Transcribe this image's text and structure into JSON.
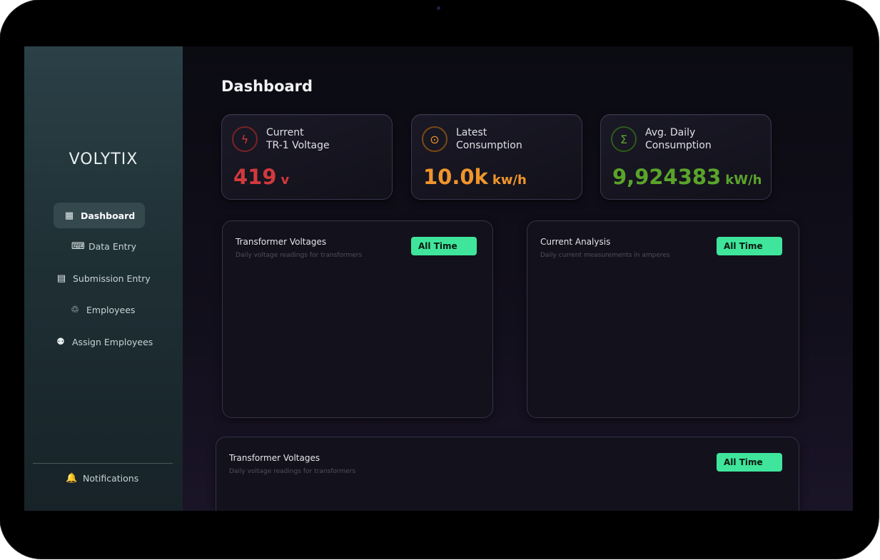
{
  "sidebar": {
    "brand": "VOLYTIX",
    "items": [
      {
        "label": "Dashboard",
        "icon": "dashboard-icon"
      },
      {
        "label": "Data Entry",
        "icon": "keyboard-icon"
      },
      {
        "label": "Submission Entry",
        "icon": "form-icon"
      },
      {
        "label": "Employees",
        "icon": "employees-icon"
      },
      {
        "label": "Assign Employees",
        "icon": "assign-user-icon"
      }
    ],
    "notifications": "Notifications"
  },
  "header": {
    "title": "Dashboard"
  },
  "stats": [
    {
      "label": "Current\nTR-1 Voltage",
      "value": "419",
      "unit": "v",
      "color": "#d2393c",
      "icon": "lightning-icon"
    },
    {
      "label": "Latest\nConsumption",
      "value": "10.0k",
      "unit": "kw/h",
      "color": "#f0952c",
      "icon": "clock-icon"
    },
    {
      "label": "Avg. Daily\nConsumption",
      "value": "9,924383",
      "unit": "kW/h",
      "color": "#5aa42a",
      "icon": "sigma-icon"
    }
  ],
  "panels": [
    {
      "title": "Transformer Voltages",
      "subtitle": "Daily voltage readings for transformers",
      "filter": "All Time"
    },
    {
      "title": "Current Analysis",
      "subtitle": "Daily current measurements in amperes",
      "filter": "All Time"
    },
    {
      "title": "Transformer Voltages",
      "subtitle": "Daily voltage readings for transformers",
      "filter": "All Time"
    }
  ],
  "colors": {
    "accent": "#3fe59b",
    "sidebar": "#1f3035",
    "background": "#0b0b12"
  }
}
